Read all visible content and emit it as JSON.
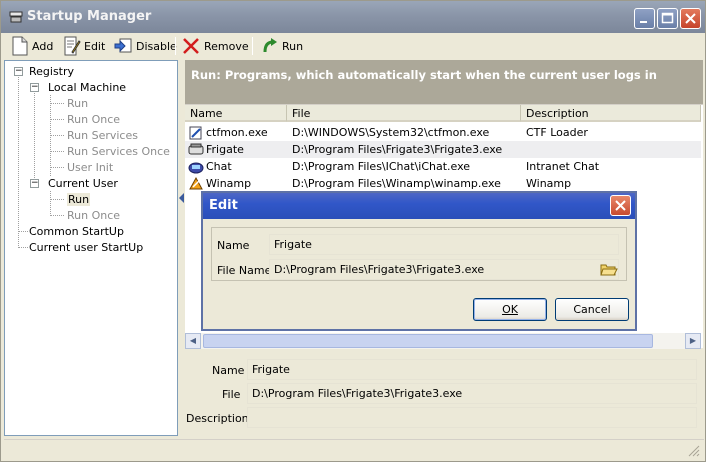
{
  "window": {
    "title": "Startup Manager"
  },
  "toolbar": {
    "add_label": "Add",
    "edit_label": "Edit",
    "disable_label": "Disable",
    "remove_label": "Remove",
    "run_label": "Run"
  },
  "tree": {
    "root": "Registry",
    "local_machine": "Local Machine",
    "lm_items": [
      "Run",
      "Run Once",
      "Run Services",
      "Run Services Once",
      "User Init"
    ],
    "current_user": "Current User",
    "cu_items": [
      "Run",
      "Run Once"
    ],
    "common_startup": "Common StartUp",
    "current_user_startup": "Current user StartUp"
  },
  "header": {
    "text": "Run: Programs, which automatically start when the current user logs in"
  },
  "list": {
    "columns": [
      "Name",
      "File",
      "Description"
    ],
    "rows": [
      {
        "name": "ctfmon.exe",
        "file": "D:\\WINDOWS\\System32\\ctfmon.exe",
        "description": "CTF Loader",
        "icon": "ctfmon-icon"
      },
      {
        "name": "Frigate",
        "file": "D:\\Program Files\\Frigate3\\Frigate3.exe",
        "description": "",
        "icon": "frigate-icon"
      },
      {
        "name": "Chat",
        "file": "D:\\Program Files\\IChat\\iChat.exe",
        "description": "Intranet Chat",
        "icon": "chat-icon"
      },
      {
        "name": "Winamp",
        "file": "D:\\Program Files\\Winamp\\winamp.exe",
        "description": "Winamp",
        "icon": "winamp-icon"
      }
    ]
  },
  "dialog": {
    "title": "Edit",
    "name_label": "Name",
    "name_value": "Frigate",
    "file_label": "File Name",
    "file_value": "D:\\Program Files\\Frigate3\\Frigate3.exe",
    "ok_label": "OK",
    "cancel_label": "Cancel"
  },
  "details": {
    "name_label": "Name",
    "name_value": "Frigate",
    "file_label": "File",
    "file_value": "D:\\Program Files\\Frigate3\\Frigate3.exe",
    "description_label": "Description",
    "description_value": ""
  },
  "colors": {
    "title_bar": "#8a95a8",
    "dialog_title": "#3157c8",
    "header_panel": "#aca899"
  }
}
